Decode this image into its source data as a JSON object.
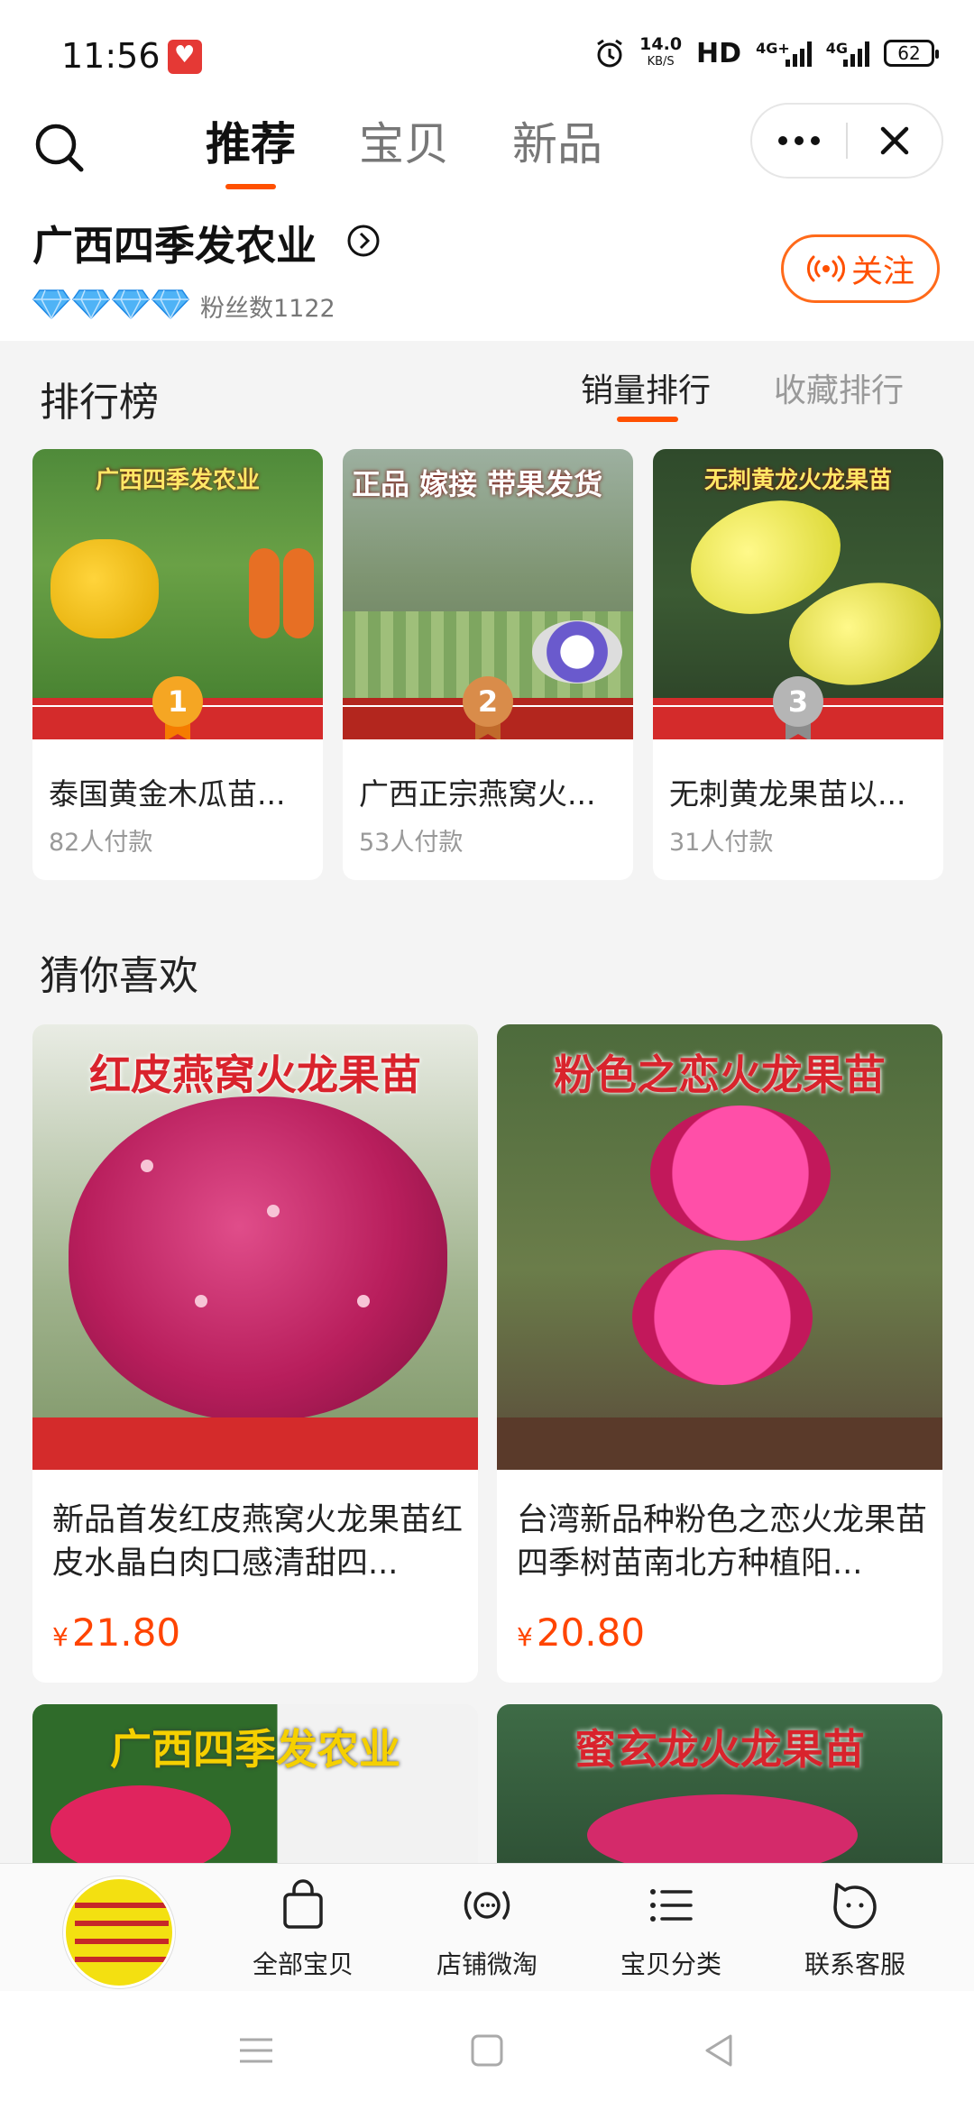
{
  "status_bar": {
    "time": "11:56",
    "net_speed_value": "14.0",
    "net_speed_unit": "KB/S",
    "hd": "HD",
    "signal1": "4G+",
    "signal2": "4G",
    "battery": "62"
  },
  "nav": {
    "tabs": [
      "推荐",
      "宝贝",
      "新品"
    ],
    "active_tab": "推荐"
  },
  "shop": {
    "name": "广西四季发农业",
    "fans_label": "粉丝数1122",
    "diamond_count": 4,
    "follow_label": "关注"
  },
  "ranking": {
    "title": "排行榜",
    "tabs": [
      "销量排行",
      "收藏排行"
    ],
    "items": [
      {
        "rank": "1",
        "name": "泰国黄金木瓜苗...",
        "sold": "82人付款",
        "img_text": "广西四季发农业"
      },
      {
        "rank": "2",
        "name": "广西正宗燕窝火...",
        "sold": "53人付款",
        "img_text": "正品 嫁接 带果发货"
      },
      {
        "rank": "3",
        "name": "无刺黄龙果苗以...",
        "sold": "31人付款",
        "img_text": "无刺黄龙火龙果苗"
      }
    ]
  },
  "recommend": {
    "title": "猜你喜欢",
    "items": [
      {
        "img_text": "红皮燕窝火龙果苗",
        "name": "新品首发红皮燕窝火龙果苗红皮水晶白肉口感清甜四...",
        "currency": "¥",
        "price": "21.80"
      },
      {
        "img_text": "粉色之恋火龙果苗",
        "name": "台湾新品种粉色之恋火龙果苗四季树苗南北方种植阳...",
        "currency": "¥",
        "price": "20.80"
      }
    ],
    "peek": [
      {
        "img_text": "广西四季发农业"
      },
      {
        "img_text": "蜜玄龙火龙果苗"
      }
    ]
  },
  "bottom_nav": {
    "items": [
      "全部宝贝",
      "店铺微淘",
      "宝贝分类",
      "联系客服"
    ]
  }
}
